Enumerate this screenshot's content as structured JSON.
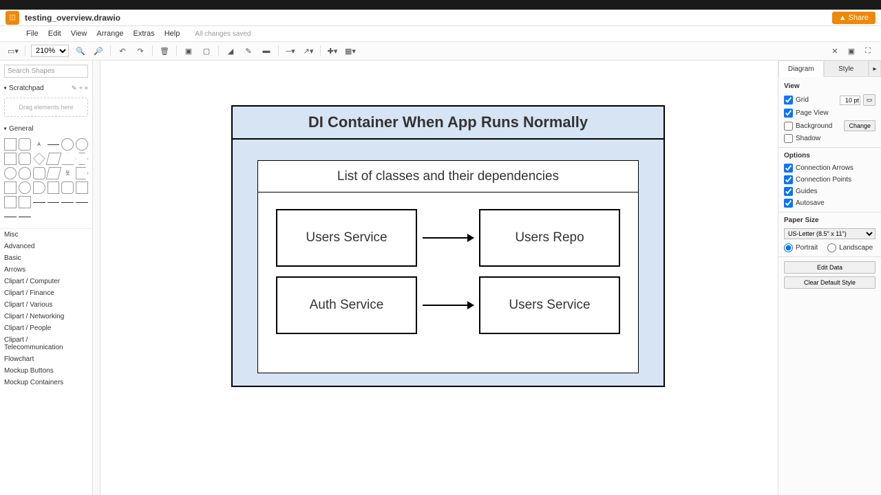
{
  "file": {
    "name": "testing_overview.drawio"
  },
  "share_label": "Share",
  "menu": {
    "items": [
      "File",
      "Edit",
      "View",
      "Arrange",
      "Extras",
      "Help"
    ],
    "status": "All changes saved"
  },
  "toolbar": {
    "zoom": "210%"
  },
  "left": {
    "search_placeholder": "Search Shapes",
    "scratchpad": {
      "title": "Scratchpad",
      "drop": "Drag elements here"
    },
    "general_title": "General",
    "categories": [
      "Misc",
      "Advanced",
      "Basic",
      "Arrows",
      "Clipart / Computer",
      "Clipart / Finance",
      "Clipart / Various",
      "Clipart / Networking",
      "Clipart / People",
      "Clipart / Telecommunication",
      "Flowchart",
      "Mockup Buttons",
      "Mockup Containers"
    ]
  },
  "diagram": {
    "container_title": "DI Container When App Runs Normally",
    "inner_title": "List of classes and their dependencies",
    "row1": {
      "from": "Users Service",
      "to": "Users Repo"
    },
    "row2": {
      "from": "Auth Service",
      "to": "Users Service"
    }
  },
  "right": {
    "tabs": {
      "diagram": "Diagram",
      "style": "Style"
    },
    "view": {
      "heading": "View",
      "grid": "Grid",
      "grid_size": "10 pt",
      "page_view": "Page View",
      "background": "Background",
      "change": "Change",
      "shadow": "Shadow"
    },
    "options": {
      "heading": "Options",
      "conn_arrows": "Connection Arrows",
      "conn_points": "Connection Points",
      "guides": "Guides",
      "autosave": "Autosave"
    },
    "paper": {
      "heading": "Paper Size",
      "size": "US-Letter (8.5\" x 11\")",
      "portrait": "Portrait",
      "landscape": "Landscape"
    },
    "buttons": {
      "edit": "Edit Data",
      "clear": "Clear Default Style"
    }
  }
}
